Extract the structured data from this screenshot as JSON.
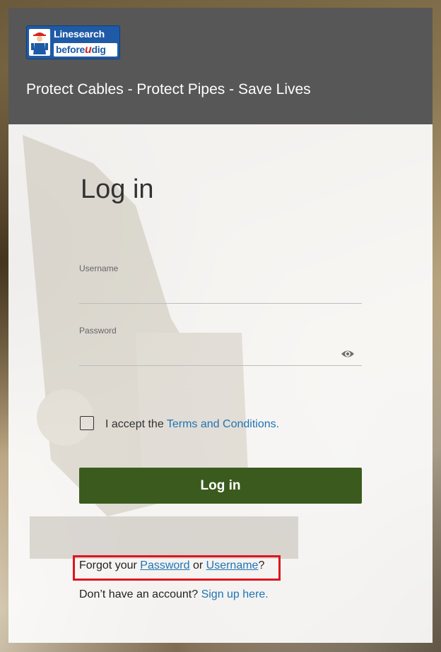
{
  "header": {
    "logo": {
      "line1": "Linesearch",
      "line2_prefix": "before",
      "line2_u": "u",
      "line2_suffix": "dig"
    },
    "tagline": "Protect Cables - Protect Pipes - Save Lives"
  },
  "form": {
    "title": "Log in",
    "username": {
      "label": "Username",
      "value": ""
    },
    "password": {
      "label": "Password",
      "value": ""
    },
    "accept": {
      "checked": false,
      "prefix": "I accept the ",
      "link": "Terms and Conditions."
    },
    "submit_label": "Log in"
  },
  "links": {
    "forgot_prefix": "Forgot your ",
    "password": "Password",
    "or": " or ",
    "username": "Username",
    "forgot_suffix": "?",
    "no_account": "Don’t have an account? ",
    "signup": "Sign up here."
  },
  "icons": {
    "logo": "linesearch-logo",
    "show_password": "eye-icon"
  },
  "colors": {
    "header_bg": "#575757",
    "primary_button": "#3b5b1e",
    "link": "#1f74b5",
    "highlight_box": "#e0141e",
    "logo_blue": "#1f5aa6",
    "logo_red": "#d7261e"
  }
}
